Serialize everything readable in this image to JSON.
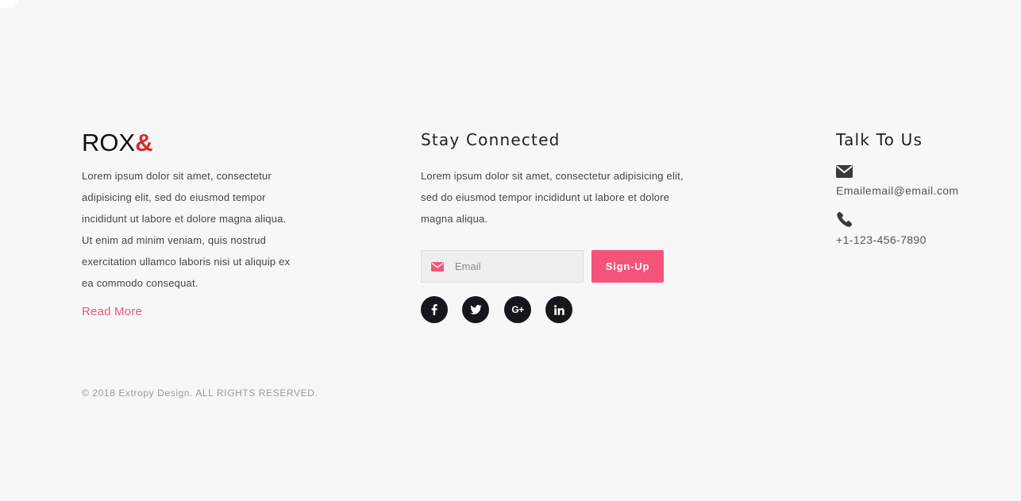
{
  "about": {
    "logo_main": "ROX",
    "logo_amp": "&",
    "text": "Lorem ipsum dolor sit amet, consectetur adipisicing elit, sed do eiusmod tempor incididunt ut labore et dolore magna aliqua. Ut enim ad minim veniam, quis nostrud exercitation ullamco laboris nisi ut aliquip ex ea commodo consequat.",
    "read_more": "Read More"
  },
  "footer": {
    "copyright": "© 2018 Extropy Design. ALL RIGHTS RESERVED."
  },
  "connect": {
    "title": "Stay Connected",
    "text": "Lorem ipsum dolor sit amet, consectetur adipisicing elit, sed do eiusmod tempor incididunt ut labore et dolore magna aliqua.",
    "email_placeholder": "Email",
    "signup_label": "Sign-Up",
    "social": [
      {
        "name": "facebook-icon"
      },
      {
        "name": "twitter-icon"
      },
      {
        "name": "google-plus-icon",
        "glyph": "G+"
      },
      {
        "name": "linkedin-icon"
      }
    ]
  },
  "talk": {
    "title": "Talk To Us",
    "email": "Emailemail@email.com",
    "phone": "+1-123-456-7890",
    "email_icon": "envelope-icon",
    "phone_icon": "phone-icon"
  },
  "colors": {
    "background": "#f7f7f7",
    "accent": "#f4547a",
    "logo_amp": "#d52b2b",
    "social_bg": "#16161c"
  }
}
